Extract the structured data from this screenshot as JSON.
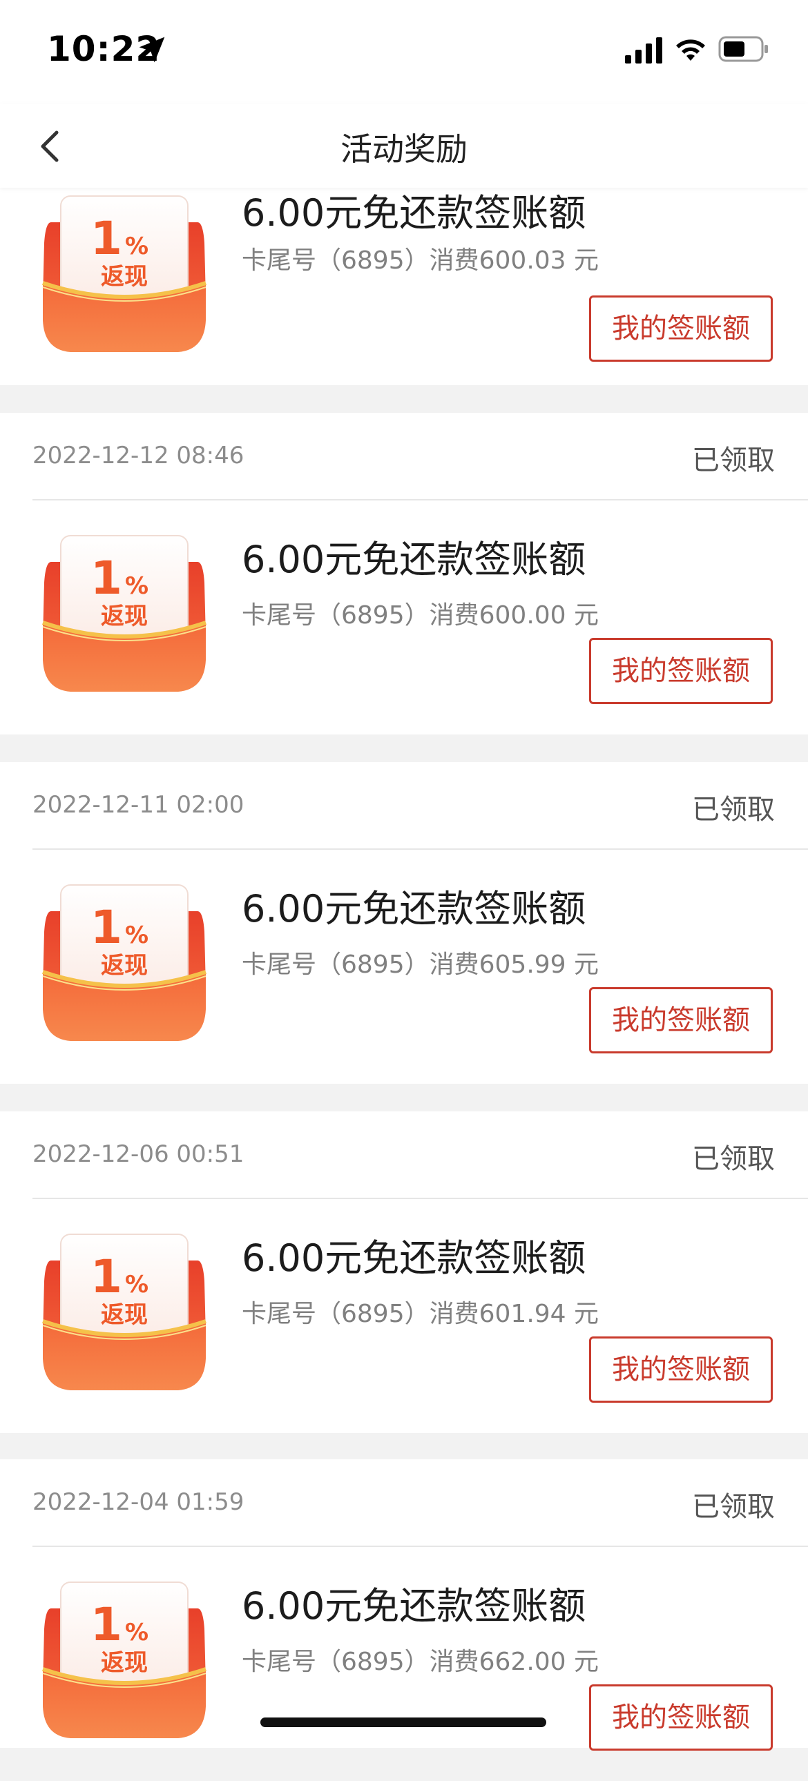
{
  "status_bar": {
    "time": "10:22"
  },
  "nav": {
    "title": "活动奖励"
  },
  "badge": {
    "percent_number": "1",
    "percent_sign": "%",
    "label": "返现"
  },
  "records": [
    {
      "date": "",
      "status": "",
      "title": "6.00元免还款签账额",
      "detail": "卡尾号（6895）消费600.03 元",
      "button": "我的签账额"
    },
    {
      "date": "2022-12-12 08:46",
      "status": "已领取",
      "title": "6.00元免还款签账额",
      "detail": "卡尾号（6895）消费600.00 元",
      "button": "我的签账额"
    },
    {
      "date": "2022-12-11 02:00",
      "status": "已领取",
      "title": "6.00元免还款签账额",
      "detail": "卡尾号（6895）消费605.99 元",
      "button": "我的签账额"
    },
    {
      "date": "2022-12-06 00:51",
      "status": "已领取",
      "title": "6.00元免还款签账额",
      "detail": "卡尾号（6895）消费601.94 元",
      "button": "我的签账额"
    },
    {
      "date": "2022-12-04 01:59",
      "status": "已领取",
      "title": "6.00元免还款签账额",
      "detail": "卡尾号（6895）消费662.00 元",
      "button": "我的签账额"
    }
  ]
}
